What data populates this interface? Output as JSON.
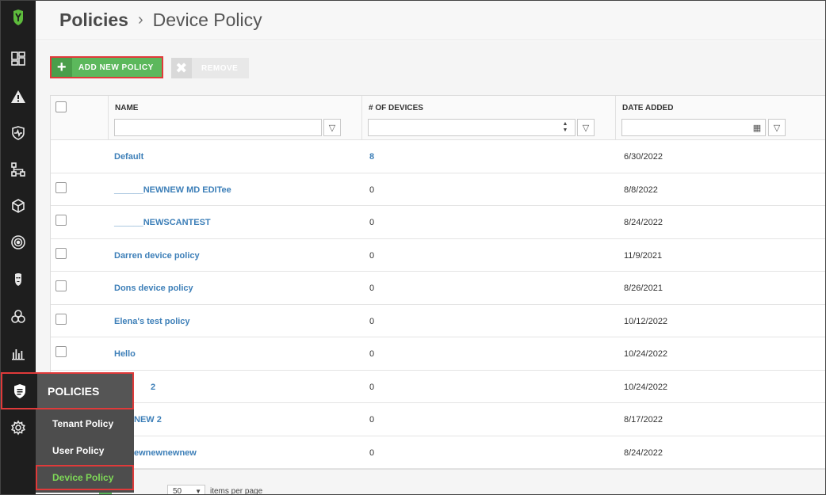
{
  "breadcrumb": {
    "root": "Policies",
    "separator": "›",
    "current": "Device Policy"
  },
  "toolbar": {
    "add_label": "ADD NEW POLICY",
    "remove_label": "REMOVE"
  },
  "table": {
    "columns": [
      "NAME",
      "# OF DEVICES",
      "DATE ADDED"
    ],
    "rows": [
      {
        "name": "Default",
        "devices": "8",
        "date": "6/30/2022"
      },
      {
        "name": "______NEWNEW MD EDITee",
        "devices": "0",
        "date": "8/8/2022"
      },
      {
        "name": "______NEWSCANTEST",
        "devices": "0",
        "date": "8/24/2022"
      },
      {
        "name": "Darren device policy",
        "devices": "0",
        "date": "11/9/2021"
      },
      {
        "name": "Dons device policy",
        "devices": "0",
        "date": "8/26/2021"
      },
      {
        "name": "Elena's test policy",
        "devices": "0",
        "date": "10/12/2022"
      },
      {
        "name": "Hello",
        "devices": "0",
        "date": "10/24/2022"
      },
      {
        "name": "2",
        "devices": "0",
        "date": "10/24/2022"
      },
      {
        "name": "NEW 2",
        "devices": "0",
        "date": "8/17/2022"
      },
      {
        "name": "ewnewnewnew",
        "devices": "0",
        "date": "8/24/2022"
      }
    ]
  },
  "pager": {
    "page_size": "50",
    "per_page_label": "items per page"
  },
  "flyout": {
    "title": "POLICIES",
    "items": [
      "Tenant Policy",
      "User Policy",
      "Device Policy"
    ]
  },
  "icons": {
    "filter": "▽",
    "calendar": "▦",
    "plus": "+",
    "remove": "✖",
    "dropdown": "▼",
    "spin_up": "▲",
    "spin_down": "▼"
  },
  "colors": {
    "brand_green": "#5dbb3c",
    "button_green": "#5cb85c",
    "link_blue": "#3d7fb8",
    "highlight_red": "#e03a3a",
    "sidebar": "#1e1e1e"
  }
}
